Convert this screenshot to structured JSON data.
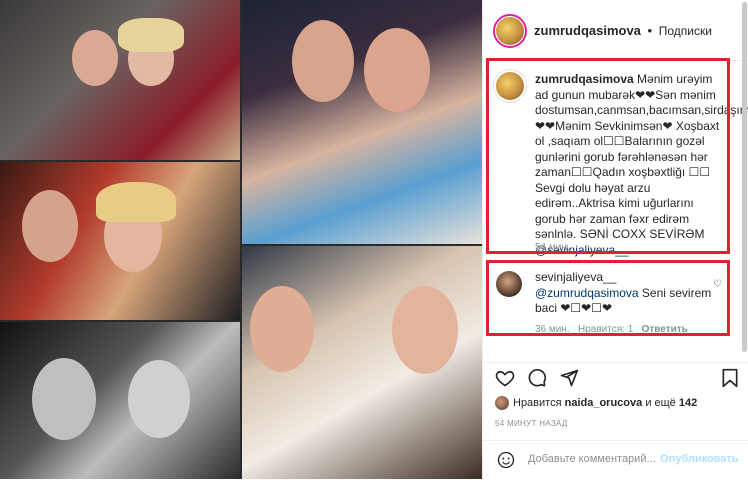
{
  "post": {
    "author": "zumrudqasimova",
    "separator": "•",
    "follow_status": "Подписки"
  },
  "caption": {
    "username": "zumrudqasimova",
    "text": "Mənim urəyim ad gunun mubarək❤❤Sən mənim dostumsan,canmsan,bacımsan,sirdaşımsan❤❤Mənim Sevkinimsən❤ Xoşbaxt ol ,saqıam ol☐☐Balarının gozəl gunlərini gorub fərəhlənəsən hər zaman☐☐Qadın xoşbəxtliğı ☐☐ Sevgi dolu həyat arzu edirəm..Aktrisa kimi uğurlarını gorub hər zaman fəxr edirəm sənlnlə. SƏNİ COXX SEVİRƏM",
    "mention": "@sevinjaliyeva__",
    "time": "54 мин."
  },
  "reply": {
    "username": "sevinjaliyeva__",
    "mention": "@zumrudqasimova",
    "text": "Seni sevirem baci ❤☐❤☐❤",
    "time": "36 мин.",
    "likes": "Нравится: 1",
    "reply_label": "Ответить",
    "heart_icon": "heart-outline-icon"
  },
  "likes": {
    "prefix": "Нравится",
    "user": "naida_orucova",
    "suffix": "и ещё",
    "count": "142"
  },
  "posted_time": "54 МИНУТ НАЗАД",
  "add_comment": {
    "placeholder": "Добавьте комментарий...",
    "publish_label": "Опубликовать"
  },
  "colors": {
    "highlight": "#e0212f",
    "link": "#00376b",
    "muted": "#8e8e8e",
    "publish_disabled": "#b2dffc"
  }
}
